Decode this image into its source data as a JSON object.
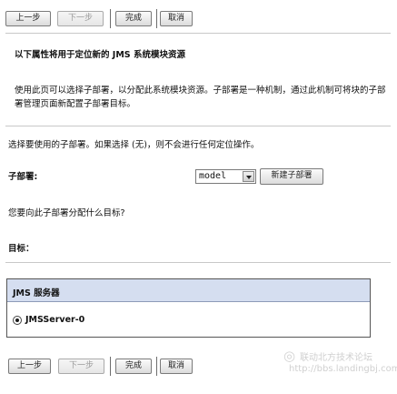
{
  "toolbar": {
    "back_label": "上一步",
    "next_label": "下一步",
    "finish_label": "完成",
    "cancel_label": "取消"
  },
  "page": {
    "title": "以下属性将用于定位新的 JMS 系统模块资源",
    "description": "使用此页可以选择子部署，以分配此系统模块资源。子部署是一种机制，通过此机制可将块的子部署管理页面新配置子部署目标。",
    "instruction": "选择要使用的子部署。如果选择 (无)，则不会进行任何定位操作。",
    "subdeployment_label": "子部署:",
    "subdeployment_value": "model",
    "new_subdeployment_label": "新建子部署",
    "target_question": "您要向此子部署分配什么目标?",
    "targets_label": "目标："
  },
  "targets_table": {
    "header": "JMS 服务器",
    "rows": [
      {
        "label": "JMSServer-0",
        "selected": true
      }
    ]
  },
  "watermark": {
    "line1": "联动北方技术论坛",
    "line2": "http://bbs.landingbj.com"
  }
}
